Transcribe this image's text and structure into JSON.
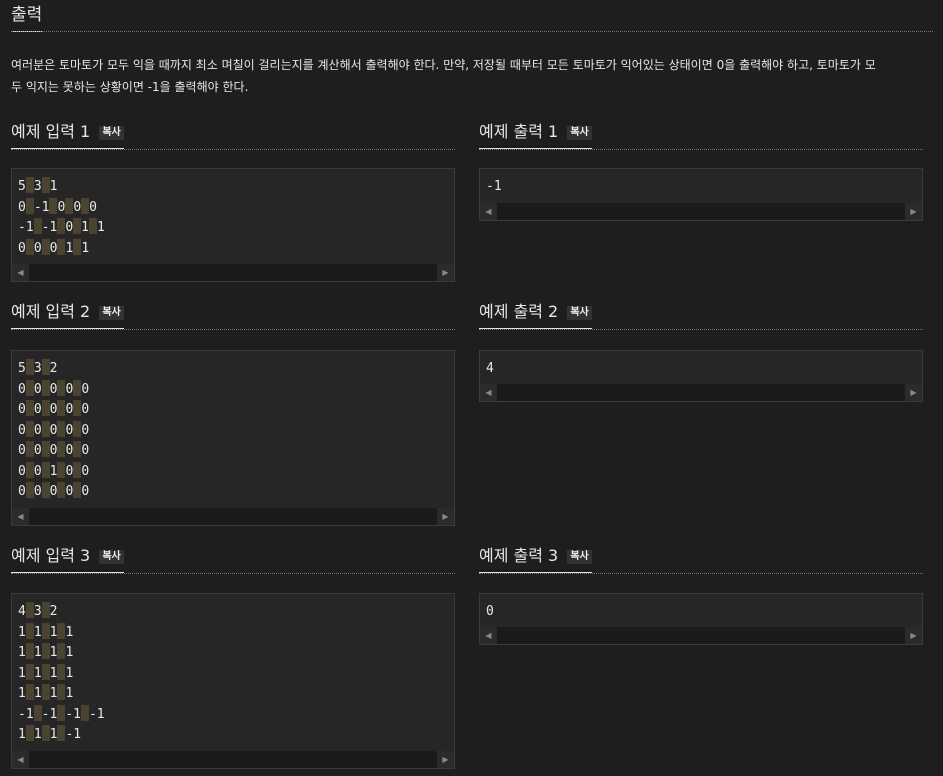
{
  "section": {
    "title": "출력",
    "description_line1": "여러분은 토마토가 모두 익을 때까지 최소 며칠이 걸리는지를 계산해서 출력해야 한다. 만약, 저장될 때부터 모든 토마토가 익어있는 상태이면 0을 출력해야 하고, 토마토가 모",
    "description_line2": "두 익지는 못하는 상황이면 -1을 출력해야 한다."
  },
  "copy_label": "복사",
  "examples": [
    {
      "input_title": "예제 입력 1",
      "output_title": "예제 출력 1",
      "input_lines": [
        [
          "5",
          "3",
          "1"
        ],
        [
          "0",
          "-1",
          "0",
          "0",
          "0"
        ],
        [
          "-1",
          "-1",
          "0",
          "1",
          "1"
        ],
        [
          "0",
          "0",
          "0",
          "1",
          "1"
        ]
      ],
      "output_lines": [
        [
          "-1"
        ]
      ]
    },
    {
      "input_title": "예제 입력 2",
      "output_title": "예제 출력 2",
      "input_lines": [
        [
          "5",
          "3",
          "2"
        ],
        [
          "0",
          "0",
          "0",
          "0",
          "0"
        ],
        [
          "0",
          "0",
          "0",
          "0",
          "0"
        ],
        [
          "0",
          "0",
          "0",
          "0",
          "0"
        ],
        [
          "0",
          "0",
          "0",
          "0",
          "0"
        ],
        [
          "0",
          "0",
          "1",
          "0",
          "0"
        ],
        [
          "0",
          "0",
          "0",
          "0",
          "0"
        ]
      ],
      "output_lines": [
        [
          "4"
        ]
      ]
    },
    {
      "input_title": "예제 입력 3",
      "output_title": "예제 출력 3",
      "input_lines": [
        [
          "4",
          "3",
          "2"
        ],
        [
          "1",
          "1",
          "1",
          "1"
        ],
        [
          "1",
          "1",
          "1",
          "1"
        ],
        [
          "1",
          "1",
          "1",
          "1"
        ],
        [
          "1",
          "1",
          "1",
          "1"
        ],
        [
          "-1",
          "-1",
          "-1",
          "-1"
        ],
        [
          "1",
          "1",
          "1",
          "-1"
        ]
      ],
      "output_lines": [
        [
          "0"
        ]
      ]
    }
  ],
  "icons": {
    "scroll_left": "triangle-left-icon",
    "scroll_right": "triangle-right-icon"
  }
}
